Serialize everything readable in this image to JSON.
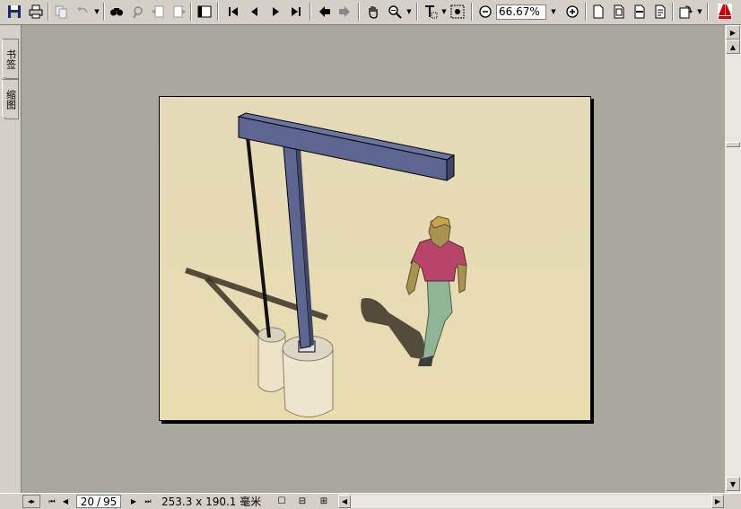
{
  "toolbar": {
    "zoom_value": "66.67%",
    "icons": [
      "save-icon",
      "print-icon",
      "copy-icon",
      "undo-icon",
      "find-icon",
      "search-files-icon",
      "page-prev-arrange-icon",
      "page-next-arrange-icon",
      "bookmark-pane-icon",
      "first-page-icon",
      "previous-page-icon",
      "next-page-icon",
      "last-page-icon",
      "back-view-icon",
      "forward-view-icon",
      "hand-tool-icon",
      "zoom-tool-icon",
      "text-select-icon",
      "snapshot-icon",
      "zoom-out-icon",
      "zoom-in-icon",
      "actual-size-icon",
      "fit-page-icon",
      "fit-width-icon",
      "reflow-icon",
      "rotate-icon",
      "adobe-logo-icon"
    ]
  },
  "side_tabs": {
    "bookmarks": "书签",
    "thumbnails": "缩图"
  },
  "status": {
    "page_current": "20",
    "page_total": "95",
    "page_sep": "/",
    "page_size": "253.3 x 190.1 毫米"
  },
  "colors": {
    "chrome": "#d4d0c8",
    "workspace": "#a8a89c",
    "page_top": "#e3d8b7",
    "page_bottom": "#e8dcb2",
    "beam": "#5c6690",
    "shirt": "#b8446a",
    "pants": "#8fb596"
  }
}
